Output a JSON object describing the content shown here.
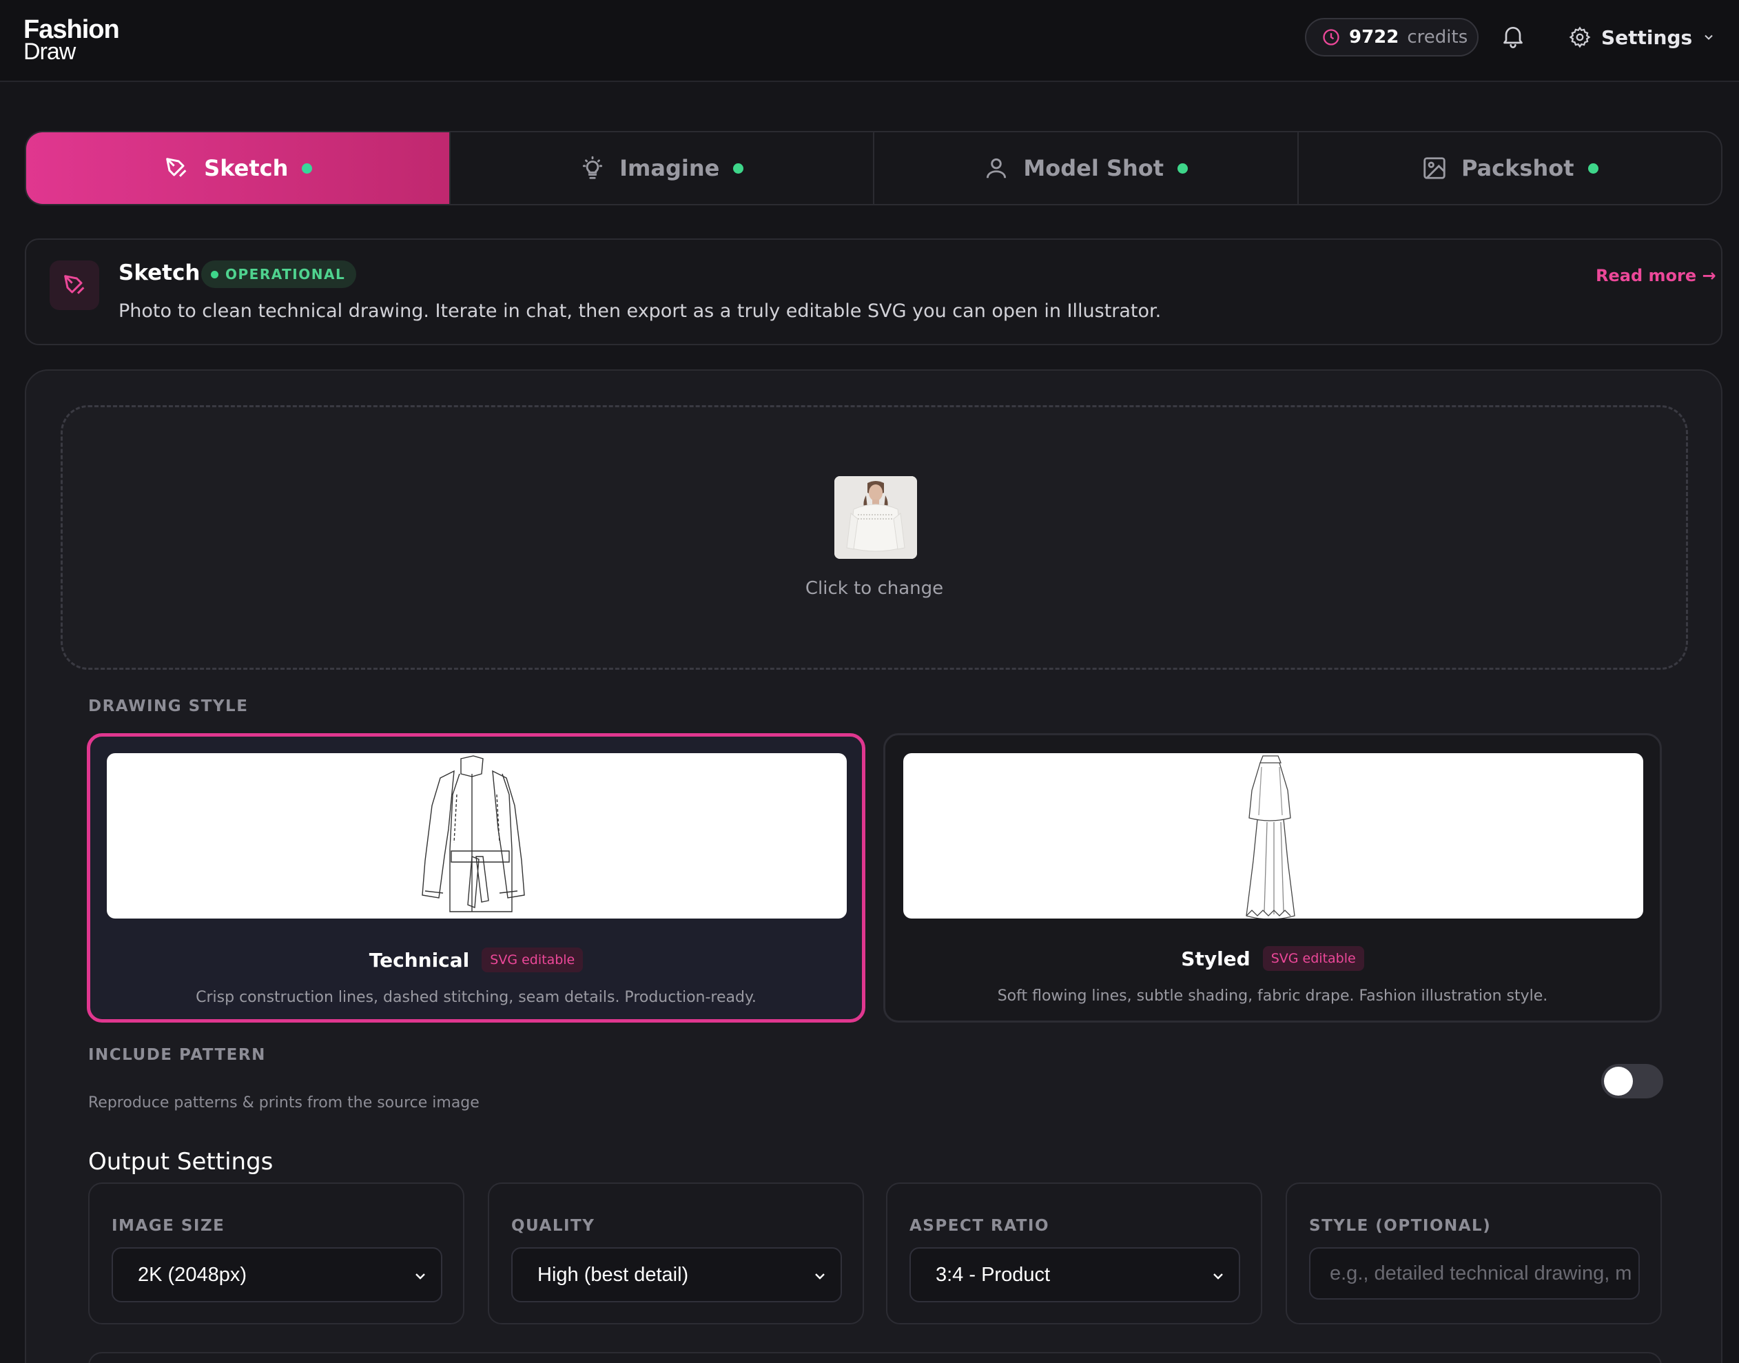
{
  "logo": {
    "line1": "Fashion",
    "line2": "Draw"
  },
  "header": {
    "credits_value": "9722",
    "credits_label": "credits",
    "settings_label": "Settings"
  },
  "tabs": [
    {
      "label": "Sketch",
      "active": true
    },
    {
      "label": "Imagine",
      "active": false
    },
    {
      "label": "Model Shot",
      "active": false
    },
    {
      "label": "Packshot",
      "active": false
    }
  ],
  "info": {
    "title": "Sketch",
    "status": "OPERATIONAL",
    "description": "Photo to clean technical drawing. Iterate in chat, then export as a truly editable SVG you can open in Illustrator.",
    "read_more": "Read more →"
  },
  "upload": {
    "label": "Click to change"
  },
  "drawing_style": {
    "section_label": "DRAWING STYLE",
    "options": [
      {
        "name": "Technical",
        "badge": "SVG editable",
        "description": "Crisp construction lines, dashed stitching, seam details. Production-ready.",
        "selected": true
      },
      {
        "name": "Styled",
        "badge": "SVG editable",
        "description": "Soft flowing lines, subtle shading, fabric drape. Fashion illustration style.",
        "selected": false
      }
    ]
  },
  "pattern": {
    "label": "INCLUDE PATTERN",
    "description": "Reproduce patterns & prints from the source image",
    "enabled": false
  },
  "output": {
    "title": "Output Settings",
    "image_size": {
      "label": "IMAGE SIZE",
      "value": "2K (2048px)"
    },
    "quality": {
      "label": "QUALITY",
      "value": "High (best detail)"
    },
    "aspect_ratio": {
      "label": "ASPECT RATIO",
      "value": "3:4 - Product"
    },
    "style": {
      "label": "STYLE (OPTIONAL)",
      "placeholder": "e.g., detailed technical drawing, m"
    }
  },
  "colors": {
    "accent": "#e0378f",
    "status_green": "#3ed68a",
    "background": "#151519"
  }
}
